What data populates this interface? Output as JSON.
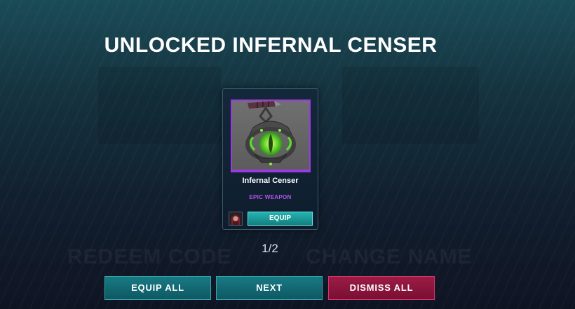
{
  "title": "UNLOCKED INFERNAL CENSER",
  "background_menu": {
    "left_label": "REDEEM CODE",
    "right_label": "CHANGE NAME"
  },
  "item_card": {
    "name": "Infernal Censer",
    "rarity": "EPIC WEAPON",
    "equip_label": "EQUIP",
    "icon": "infernal-censer-icon",
    "hero_icon": "hero-portrait-icon"
  },
  "pagination": {
    "text": "1/2",
    "current": 1,
    "total": 2
  },
  "actions": {
    "equip_all_label": "EQUIP ALL",
    "next_label": "NEXT",
    "dismiss_all_label": "DISMISS ALL"
  },
  "colors": {
    "rarity_epic": "#b855f0",
    "teal_button": "#187a84",
    "dismiss_button": "#9c1c46",
    "equip_button": "#24b3b1"
  }
}
